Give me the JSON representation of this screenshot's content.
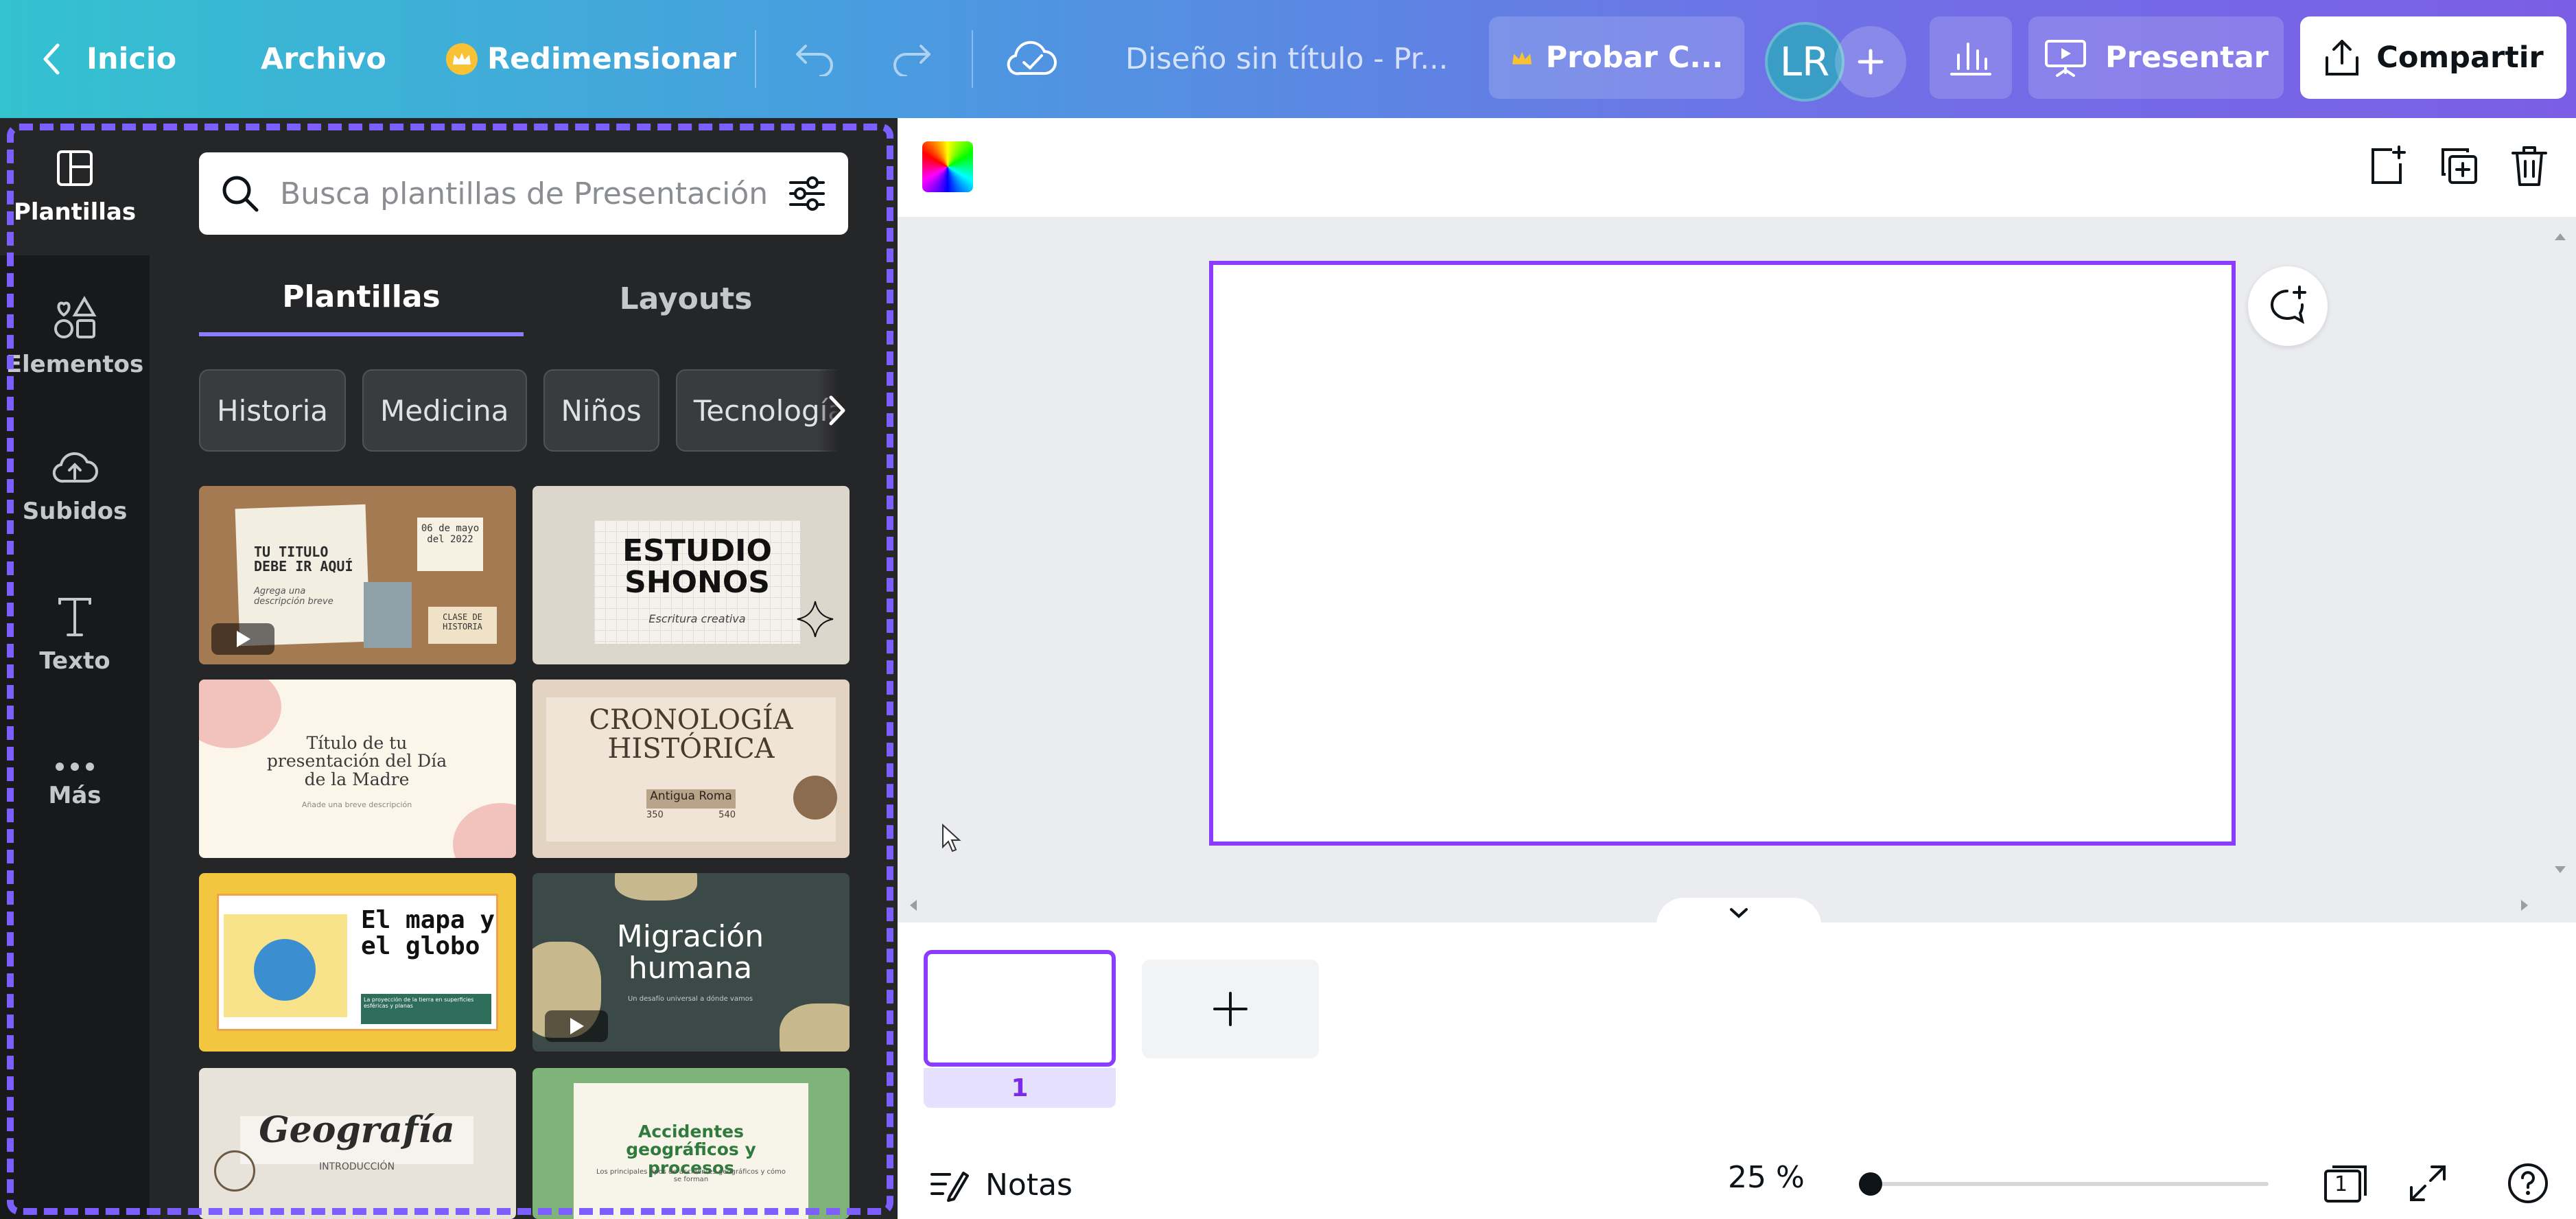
{
  "topbar": {
    "home_label": "Inicio",
    "file_label": "Archivo",
    "resize_label": "Redimensionar",
    "doc_title": "Diseño sin título - Pr...",
    "try_label": "Probar C...",
    "avatar_initials": "LR",
    "present_label": "Presentar",
    "share_label": "Compartir"
  },
  "rail": {
    "items": [
      {
        "label": "Plantillas",
        "icon": "layout-icon"
      },
      {
        "label": "Elementos",
        "icon": "shapes-icon"
      },
      {
        "label": "Subidos",
        "icon": "cloud-upload-icon"
      },
      {
        "label": "Texto",
        "icon": "text-icon"
      },
      {
        "label": "Más",
        "icon": "more-icon"
      }
    ]
  },
  "panel": {
    "search_placeholder": "Busca plantillas de Presentación",
    "tabs": [
      "Plantillas",
      "Layouts"
    ],
    "chips": [
      "Historia",
      "Medicina",
      "Niños",
      "Tecnología"
    ],
    "templates": [
      {
        "title": "TU TITULO DEBE IR AQUÍ",
        "subtitle": "Agrega una descripción breve",
        "date": "06 de mayo del 2022",
        "tag": "CLASE DE HISTORIA"
      },
      {
        "title": "ESTUDIO SHONOS",
        "subtitle": "Escritura creativa"
      },
      {
        "title": "Título de tu presentación del Día de la Madre",
        "subtitle": "Añade una breve descripción"
      },
      {
        "title": "CRONOLOGÍA HISTÓRICA",
        "subtitle": "Antigua Roma",
        "range_start": "350",
        "range_end": "540"
      },
      {
        "title": "El mapa y el globo",
        "subtitle": "La proyección de la tierra en superficies esféricas y planas"
      },
      {
        "title": "Migración humana",
        "subtitle": "Un desafío universal a dónde vamos"
      },
      {
        "title": "Geografía",
        "subtitle": "INTRODUCCIÓN"
      },
      {
        "title": "Accidentes geográficos y procesos",
        "subtitle": "Los principales tipos de accidentes geográficos y cómo se forman"
      }
    ]
  },
  "editor": {
    "page_number": "1",
    "notes_label": "Notas",
    "zoom_label": "25 %",
    "page_count": "1",
    "zoom_fraction": 0.02
  },
  "colors": {
    "accent": "#8b3dff",
    "panel_bg": "#252627",
    "rail_bg": "#18191b"
  }
}
